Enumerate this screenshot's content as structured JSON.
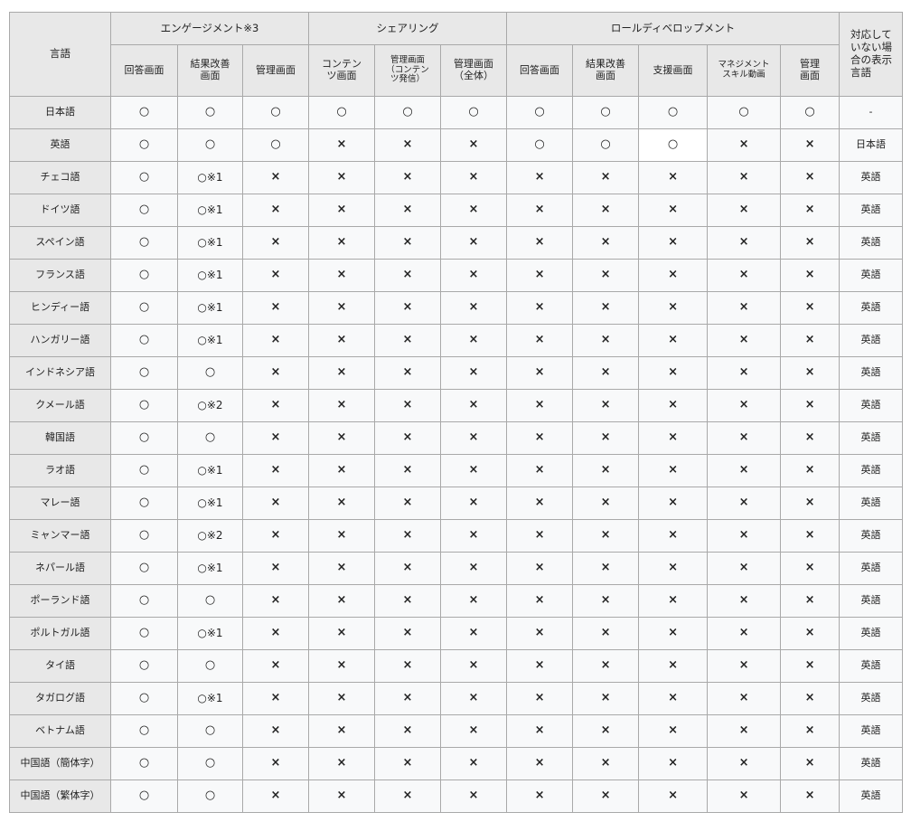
{
  "header": {
    "language": "言語",
    "fallback": "対応して\nいない場\n合の表示\n言語",
    "groups": [
      {
        "label": "エンゲージメント※3",
        "span": 3
      },
      {
        "label": "シェアリング",
        "span": 3
      },
      {
        "label": "ロールディベロップメント",
        "span": 5
      }
    ],
    "columns": [
      "回答画面",
      "結果改善\n画面",
      "管理画面",
      "コンテン\nツ画面",
      "管理画面\n（コンテン\nツ発信）",
      "管理画面\n（全体）",
      "回答画面",
      "結果改善\n画面",
      "支援画面",
      "マネジメント\nスキル動画",
      "管理\n画面"
    ]
  },
  "rows": [
    {
      "lang": "日本語",
      "cells": [
        "○",
        "○",
        "○",
        "○",
        "○",
        "○",
        "○",
        "○",
        "○",
        "○",
        "○"
      ],
      "fallback": "-"
    },
    {
      "lang": "英語",
      "cells": [
        "○",
        "○",
        "○",
        "×",
        "×",
        "×",
        "○",
        "○",
        "○",
        "×",
        "×"
      ],
      "fallback": "日本語"
    },
    {
      "lang": "チェコ語",
      "cells": [
        "○",
        "○※1",
        "×",
        "×",
        "×",
        "×",
        "×",
        "×",
        "×",
        "×",
        "×"
      ],
      "fallback": "英語"
    },
    {
      "lang": "ドイツ語",
      "cells": [
        "○",
        "○※1",
        "×",
        "×",
        "×",
        "×",
        "×",
        "×",
        "×",
        "×",
        "×"
      ],
      "fallback": "英語"
    },
    {
      "lang": "スペイン語",
      "cells": [
        "○",
        "○※1",
        "×",
        "×",
        "×",
        "×",
        "×",
        "×",
        "×",
        "×",
        "×"
      ],
      "fallback": "英語"
    },
    {
      "lang": "フランス語",
      "cells": [
        "○",
        "○※1",
        "×",
        "×",
        "×",
        "×",
        "×",
        "×",
        "×",
        "×",
        "×"
      ],
      "fallback": "英語"
    },
    {
      "lang": "ヒンディー語",
      "cells": [
        "○",
        "○※1",
        "×",
        "×",
        "×",
        "×",
        "×",
        "×",
        "×",
        "×",
        "×"
      ],
      "fallback": "英語"
    },
    {
      "lang": "ハンガリー語",
      "cells": [
        "○",
        "○※1",
        "×",
        "×",
        "×",
        "×",
        "×",
        "×",
        "×",
        "×",
        "×"
      ],
      "fallback": "英語"
    },
    {
      "lang": "インドネシア語",
      "cells": [
        "○",
        "○",
        "×",
        "×",
        "×",
        "×",
        "×",
        "×",
        "×",
        "×",
        "×"
      ],
      "fallback": "英語"
    },
    {
      "lang": "クメール語",
      "cells": [
        "○",
        "○※2",
        "×",
        "×",
        "×",
        "×",
        "×",
        "×",
        "×",
        "×",
        "×"
      ],
      "fallback": "英語"
    },
    {
      "lang": "韓国語",
      "cells": [
        "○",
        "○",
        "×",
        "×",
        "×",
        "×",
        "×",
        "×",
        "×",
        "×",
        "×"
      ],
      "fallback": "英語"
    },
    {
      "lang": "ラオ語",
      "cells": [
        "○",
        "○※1",
        "×",
        "×",
        "×",
        "×",
        "×",
        "×",
        "×",
        "×",
        "×"
      ],
      "fallback": "英語"
    },
    {
      "lang": "マレー語",
      "cells": [
        "○",
        "○※1",
        "×",
        "×",
        "×",
        "×",
        "×",
        "×",
        "×",
        "×",
        "×"
      ],
      "fallback": "英語"
    },
    {
      "lang": "ミャンマー語",
      "cells": [
        "○",
        "○※2",
        "×",
        "×",
        "×",
        "×",
        "×",
        "×",
        "×",
        "×",
        "×"
      ],
      "fallback": "英語"
    },
    {
      "lang": "ネパール語",
      "cells": [
        "○",
        "○※1",
        "×",
        "×",
        "×",
        "×",
        "×",
        "×",
        "×",
        "×",
        "×"
      ],
      "fallback": "英語"
    },
    {
      "lang": "ポーランド語",
      "cells": [
        "○",
        "○",
        "×",
        "×",
        "×",
        "×",
        "×",
        "×",
        "×",
        "×",
        "×"
      ],
      "fallback": "英語"
    },
    {
      "lang": "ポルトガル語",
      "cells": [
        "○",
        "○※1",
        "×",
        "×",
        "×",
        "×",
        "×",
        "×",
        "×",
        "×",
        "×"
      ],
      "fallback": "英語"
    },
    {
      "lang": "タイ語",
      "cells": [
        "○",
        "○",
        "×",
        "×",
        "×",
        "×",
        "×",
        "×",
        "×",
        "×",
        "×"
      ],
      "fallback": "英語"
    },
    {
      "lang": "タガログ語",
      "cells": [
        "○",
        "○※1",
        "×",
        "×",
        "×",
        "×",
        "×",
        "×",
        "×",
        "×",
        "×"
      ],
      "fallback": "英語"
    },
    {
      "lang": "ベトナム語",
      "cells": [
        "○",
        "○",
        "×",
        "×",
        "×",
        "×",
        "×",
        "×",
        "×",
        "×",
        "×"
      ],
      "fallback": "英語"
    },
    {
      "lang": "中国語（簡体字）",
      "cells": [
        "○",
        "○",
        "×",
        "×",
        "×",
        "×",
        "×",
        "×",
        "×",
        "×",
        "×"
      ],
      "fallback": "英語"
    },
    {
      "lang": "中国語（繁体字）",
      "cells": [
        "○",
        "○",
        "×",
        "×",
        "×",
        "×",
        "×",
        "×",
        "×",
        "×",
        "×"
      ],
      "fallback": "英語"
    }
  ],
  "colors": {
    "header_bg": "#e8e8e8",
    "cell_bg": "#f8f9fa",
    "highlight_bg": "#ffffff",
    "border": "#a9a9a9"
  }
}
